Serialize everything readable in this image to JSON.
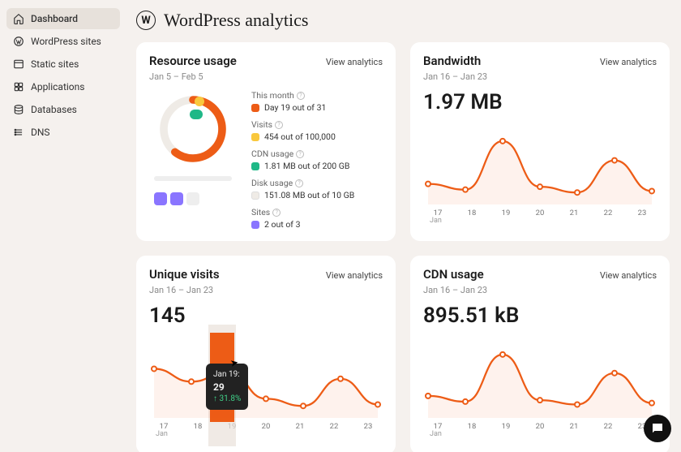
{
  "sidebar": {
    "items": [
      {
        "label": "Dashboard",
        "icon": "house",
        "active": true
      },
      {
        "label": "WordPress sites",
        "icon": "wp",
        "active": false
      },
      {
        "label": "Static sites",
        "icon": "window",
        "active": false
      },
      {
        "label": "Applications",
        "icon": "grid",
        "active": false
      },
      {
        "label": "Databases",
        "icon": "db",
        "active": false
      },
      {
        "label": "DNS",
        "icon": "dns",
        "active": false
      }
    ]
  },
  "page": {
    "title": "WordPress analytics"
  },
  "colors": {
    "orange": "#ed5c16",
    "yellow": "#f9c83d",
    "green": "#1fb887",
    "purple": "#8a75ff",
    "track": "#efebe6"
  },
  "common": {
    "view_analytics": "View analytics"
  },
  "resource": {
    "title": "Resource usage",
    "range": "Jan 5 – Feb 5",
    "items": [
      {
        "label": "This month",
        "val": "Day 19 out of 31",
        "color": "orange"
      },
      {
        "label": "Visits",
        "val": "454 out of 100,000",
        "color": "yellow"
      },
      {
        "label": "CDN usage",
        "val": "1.81 MB out of 200 GB",
        "color": "green"
      },
      {
        "label": "Disk usage",
        "val": "151.08 MB out of 10 GB",
        "color": "track"
      },
      {
        "label": "Sites",
        "val": "2 out of 3",
        "color": "purple"
      }
    ],
    "donut_percent": 61
  },
  "bandwidth": {
    "title": "Bandwidth",
    "range": "Jan 16 – Jan 23",
    "value": "1.97 MB"
  },
  "visits": {
    "title": "Unique visits",
    "range": "Jan 16 – Jan 23",
    "value": "145",
    "tooltip": {
      "date": "Jan 19:",
      "value": "29",
      "pct": "31.8%"
    }
  },
  "cdn": {
    "title": "CDN usage",
    "range": "Jan 16 – Jan 23",
    "value": "895.51 kB"
  },
  "chart_data": [
    {
      "type": "line",
      "id": "bandwidth",
      "categories": [
        "17",
        "18",
        "19",
        "20",
        "21",
        "22",
        "23"
      ],
      "x_month": "Jan",
      "y_rel": [
        22,
        14,
        82,
        18,
        10,
        55,
        12
      ],
      "note": "values are relative heights (no y-axis shown)"
    },
    {
      "type": "line",
      "id": "visits",
      "categories": [
        "17",
        "18",
        "19",
        "20",
        "21",
        "22",
        "23"
      ],
      "x_month": "Jan",
      "y_rel": [
        62,
        44,
        58,
        20,
        10,
        48,
        12
      ],
      "highlight_index": 2,
      "highlight_value": 29
    },
    {
      "type": "line",
      "id": "cdn",
      "categories": [
        "17",
        "18",
        "19",
        "20",
        "21",
        "22",
        "23"
      ],
      "x_month": "Jan",
      "y_rel": [
        24,
        16,
        82,
        18,
        12,
        56,
        14
      ]
    }
  ]
}
